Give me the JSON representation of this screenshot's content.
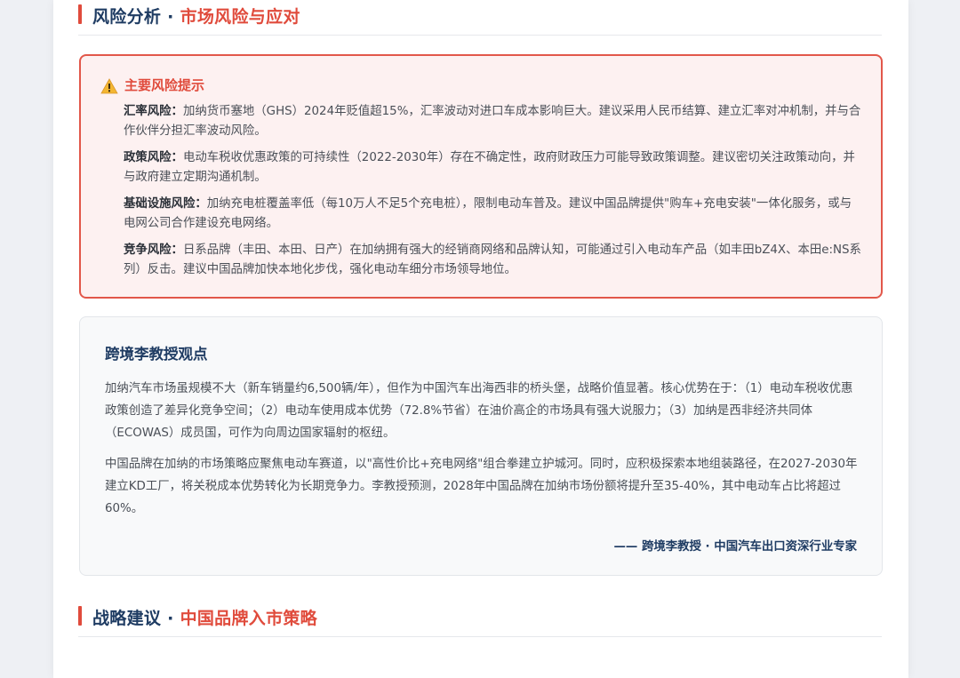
{
  "risk_section": {
    "title_main": "风险分析 · ",
    "title_accent": "市场风险与应对"
  },
  "risk_box": {
    "icon": "warning-icon",
    "title": "主要风险提示",
    "items": [
      {
        "label": "汇率风险：",
        "text": "加纳货币塞地（GHS）2024年贬值超15%，汇率波动对进口车成本影响巨大。建议采用人民币结算、建立汇率对冲机制，并与合作伙伴分担汇率波动风险。"
      },
      {
        "label": "政策风险：",
        "text": "电动车税收优惠政策的可持续性（2022-2030年）存在不确定性，政府财政压力可能导致政策调整。建议密切关注政策动向，并与政府建立定期沟通机制。"
      },
      {
        "label": "基础设施风险：",
        "text": "加纳充电桩覆盖率低（每10万人不足5个充电桩），限制电动车普及。建议中国品牌提供\"购车+充电安装\"一体化服务，或与电网公司合作建设充电网络。"
      },
      {
        "label": "竞争风险：",
        "text": "日系品牌（丰田、本田、日产）在加纳拥有强大的经销商网络和品牌认知，可能通过引入电动车产品（如丰田bZ4X、本田e:NS系列）反击。建议中国品牌加快本地化步伐，强化电动车细分市场领导地位。"
      }
    ]
  },
  "opinion": {
    "title": "跨境李教授观点",
    "paragraphs": [
      "加纳汽车市场虽规模不大（新车销量约6,500辆/年），但作为中国汽车出海西非的桥头堡，战略价值显著。核心优势在于：（1）电动车税收优惠政策创造了差异化竞争空间；（2）电动车使用成本优势（72.8%节省）在油价高企的市场具有强大说服力；（3）加纳是西非经济共同体（ECOWAS）成员国，可作为向周边国家辐射的枢纽。",
      "中国品牌在加纳的市场策略应聚焦电动车赛道，以\"高性价比+充电网络\"组合拳建立护城河。同时，应积极探索本地组装路径，在2027-2030年建立KD工厂，将关税成本优势转化为长期竞争力。李教授预测，2028年中国品牌在加纳市场份额将提升至35-40%，其中电动车占比将超过60%。"
    ],
    "signature": "—— 跨境李教授 · 中国汽车出口资深行业专家"
  },
  "strategy_section": {
    "title_main": "战略建议 · ",
    "title_accent": "中国品牌入市策略"
  },
  "colors": {
    "accent_red": "#e04b3c",
    "navy": "#1f3c63",
    "risk_bg": "#fdf1f1",
    "opinion_bg": "#f8f9fa"
  }
}
